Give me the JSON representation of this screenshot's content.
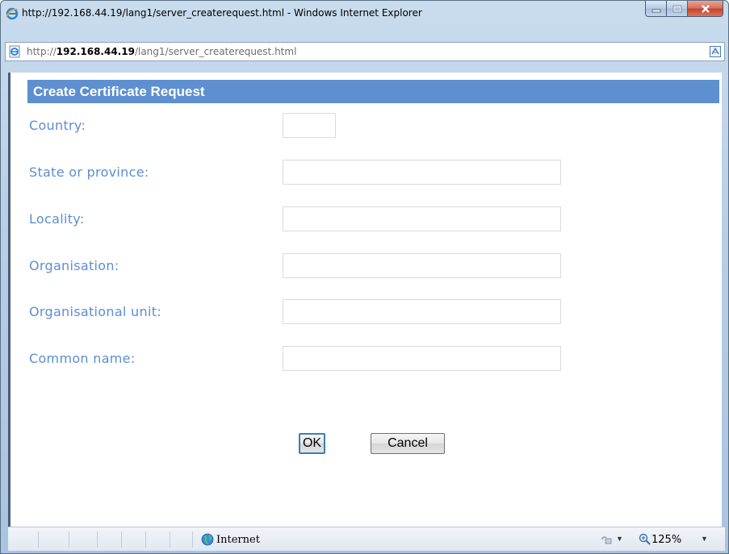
{
  "window": {
    "title": "http://192.168.44.19/lang1/server_createrequest.html - Windows Internet Explorer"
  },
  "address": {
    "prefix": "http://",
    "host": "192.168.44.19",
    "path": "/lang1/server_createrequest.html"
  },
  "form": {
    "header": "Create Certificate Request",
    "fields": [
      {
        "label": "Country:",
        "value": ""
      },
      {
        "label": "State or province:",
        "value": ""
      },
      {
        "label": "Locality:",
        "value": ""
      },
      {
        "label": "Organisation:",
        "value": ""
      },
      {
        "label": "Organisational unit:",
        "value": ""
      },
      {
        "label": "Common name:",
        "value": ""
      }
    ],
    "ok_label": "OK",
    "cancel_label": "Cancel"
  },
  "statusbar": {
    "zone": "Internet",
    "zoom": "125%"
  },
  "colors": {
    "header_bg": "#5e8fd0",
    "label_text": "#5b8ed2"
  },
  "icons": {
    "title": "ie-icon",
    "address": "page-icon",
    "address_right": "compat-view-icon",
    "zone": "globe-icon",
    "protected": "protected-mode-icon",
    "zoom": "zoom-icon"
  }
}
